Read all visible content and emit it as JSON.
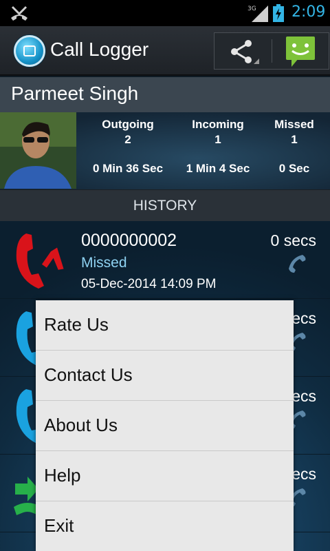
{
  "status_bar": {
    "time": "2:09",
    "network": "3G",
    "icons": [
      "missed-call-icon",
      "signal-icon",
      "battery-charging-icon"
    ],
    "clock_color": "#33b5e5"
  },
  "action_bar": {
    "title": "Call Logger",
    "actions": [
      "share-icon",
      "sms-icon"
    ]
  },
  "contact": {
    "name": "Parmeet Singh",
    "stats": [
      {
        "label": "Outgoing",
        "count": "2",
        "duration": "0 Min 36 Sec"
      },
      {
        "label": "Incoming",
        "count": "1",
        "duration": "1 Min 4 Sec"
      },
      {
        "label": "Missed",
        "count": "1",
        "duration": "0 Sec"
      }
    ]
  },
  "history": {
    "header": "HISTORY",
    "calls": [
      {
        "number": "0000000002",
        "type": "Missed",
        "date": "05-Dec-2014 14:09 PM",
        "duration": "0 secs",
        "icon": "missed-call-icon",
        "color": "#d9131a"
      },
      {
        "duration": "secs",
        "icon": "incoming-call-icon",
        "color": "#1aa2e0"
      },
      {
        "duration": "secs",
        "icon": "incoming-call-icon",
        "color": "#1aa2e0"
      },
      {
        "duration": "secs",
        "icon": "outgoing-call-icon",
        "color": "#27b04a"
      }
    ]
  },
  "menu": {
    "items": [
      "Rate Us",
      "Contact Us",
      "About Us",
      "Help",
      "Exit"
    ]
  },
  "colors": {
    "accent": "#33b5e5",
    "missed": "#d9131a",
    "menu_bg": "#e8e8e8"
  }
}
